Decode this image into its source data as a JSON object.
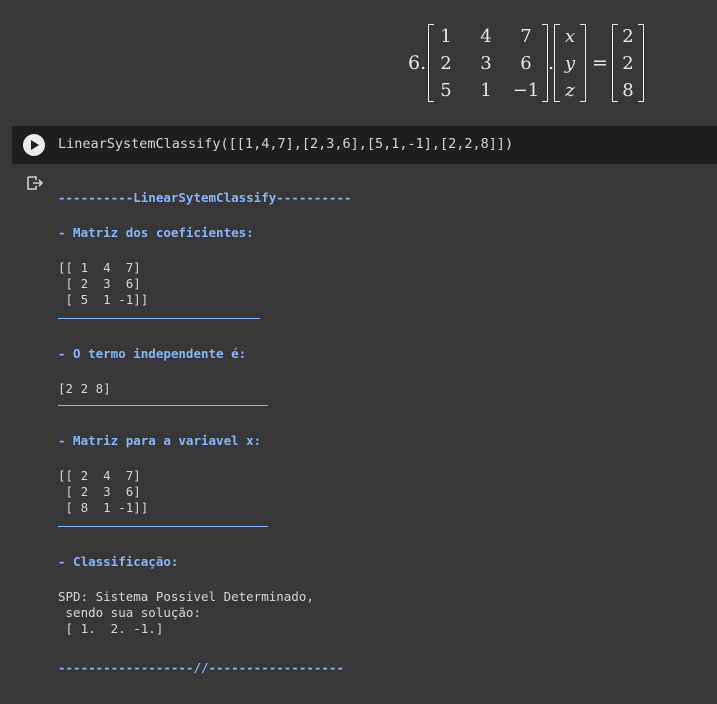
{
  "equation": {
    "number": "6.",
    "matrix_a": [
      [
        "1",
        "4",
        "7"
      ],
      [
        "2",
        "3",
        "6"
      ],
      [
        "5",
        "1",
        "−1"
      ]
    ],
    "vars": [
      "x",
      "y",
      "z"
    ],
    "rhs": [
      "2",
      "2",
      "8"
    ],
    "dot": ".",
    "equals": "="
  },
  "code_cell": {
    "fn": "LinearSystemClassify",
    "args_prefix": "([[",
    "code_text": "LinearSystemClassify([[1,4,7],[2,3,6],[5,1,-1],[2,2,8]])"
  },
  "output": {
    "title": "----------LinearSytemClassify----------",
    "coef_header": "- Matriz dos coeficientes:",
    "coef_matrix": "[[ 1  4  7]\n [ 2  3  6]\n [ 5  1 -1]]",
    "indep_header": "- O termo independente é:",
    "indep_vector": "[2 2 8]",
    "x_header": "- Matriz para a variavel x:",
    "x_matrix": "[[ 2  4  7]\n [ 2  3  6]\n [ 8  1 -1]]",
    "class_header": "- Classificação:",
    "class_text": "SPD: Sistema Possivel Determinado,\n sendo sua solução:\n [ 1.  2. -1.]",
    "footer": "------------------//------------------"
  },
  "colors": {
    "background": "#383838",
    "code_bg": "#1e1e1e",
    "accent": "#8ab4f8"
  }
}
